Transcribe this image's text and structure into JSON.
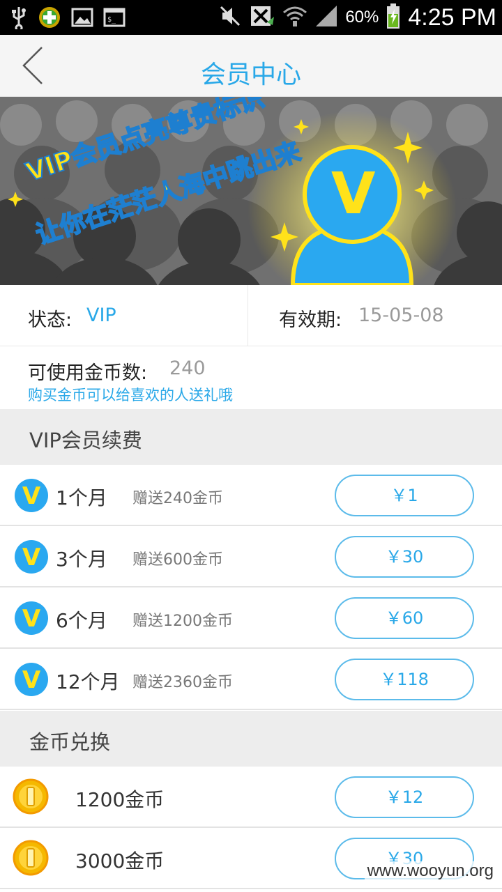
{
  "statusbar": {
    "battery_pct": "60%",
    "time": "4:25 PM",
    "icons": [
      "usb-icon",
      "plus-app-icon",
      "image-icon",
      "terminal-icon",
      "mute-icon",
      "no-sim-icon",
      "wifi-icon",
      "signal-icon",
      "battery-icon"
    ]
  },
  "header": {
    "title": "会员中心",
    "back_icon": "chevron-left-icon"
  },
  "banner": {
    "line1": "VIP会员点亮尊贵标识",
    "line2": "让你在茫茫人海中跳出来",
    "badge_letter": "V"
  },
  "status": {
    "label": "状态:",
    "value": "VIP",
    "expiry_label": "有效期:",
    "expiry_value": "15-05-08"
  },
  "coins": {
    "label": "可使用金币数:",
    "value": "240",
    "tip": "购买金币可以给喜欢的人送礼哦"
  },
  "vip_section": {
    "title": "VIP会员续费",
    "badge_letter": "V",
    "plans": [
      {
        "name": "1个月",
        "bonus": "赠送240金币",
        "price": "￥1"
      },
      {
        "name": "3个月",
        "bonus": "赠送600金币",
        "price": "￥30"
      },
      {
        "name": "6个月",
        "bonus": "赠送1200金币",
        "price": "￥60"
      },
      {
        "name": "12个月",
        "bonus": "赠送2360金币",
        "price": "￥118"
      }
    ]
  },
  "coin_section": {
    "title": "金币兑换",
    "items": [
      {
        "name": "1200金币",
        "price": "￥12"
      },
      {
        "name": "3000金币",
        "price": "￥30"
      }
    ]
  },
  "watermark": "www.wooyun.org",
  "colors": {
    "accent": "#29a8e8",
    "vip_yellow": "#ffe21a",
    "coin_gold": "#f5b800"
  }
}
